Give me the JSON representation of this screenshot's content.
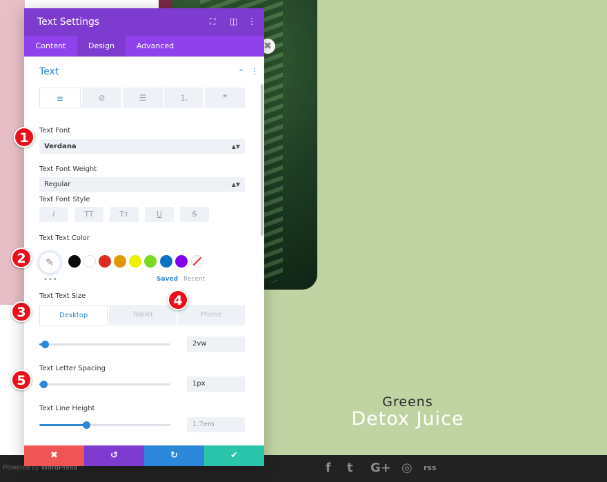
{
  "panel": {
    "title": "Text Settings",
    "header_icons": [
      "expand-icon",
      "columns-icon",
      "more-icon"
    ],
    "tabs": [
      {
        "label": "Content",
        "active": false
      },
      {
        "label": "Design",
        "active": true
      },
      {
        "label": "Advanced",
        "active": false
      }
    ],
    "section": {
      "title": "Text"
    },
    "alignment_options": [
      "align-left-icon",
      "link-off-icon",
      "list-icon",
      "ordered-list-icon",
      "quote-icon"
    ],
    "fields": {
      "font": {
        "label": "Text Font",
        "value": "Verdana"
      },
      "font_weight": {
        "label": "Text Font Weight",
        "value": "Regular"
      },
      "font_style": {
        "label": "Text Font Style",
        "options": [
          "I",
          "TT",
          "Tт",
          "U",
          "S"
        ]
      },
      "text_color": {
        "label": "Text Text Color",
        "swatches": [
          "#0b0b0b",
          "#ffffff",
          "#e02b20",
          "#e09900",
          "#edf000",
          "#7cda24",
          "#0c71c3",
          "#8300e9"
        ],
        "saved_label": "Saved",
        "recent_label": "Recent",
        "ellipsis": "•••"
      },
      "text_size": {
        "label": "Text Text Size",
        "devices": [
          {
            "label": "Desktop",
            "active": true
          },
          {
            "label": "Tablet",
            "active": false
          },
          {
            "label": "Phone",
            "active": false
          }
        ],
        "value": "2vw",
        "slider_fraction": 0.04
      },
      "letter_spacing": {
        "label": "Text Letter Spacing",
        "value": "1px",
        "slider_fraction": 0.03
      },
      "line_height": {
        "label": "Text Line Height",
        "value": "1.7em",
        "slider_fraction": 0.36
      }
    },
    "actions": {
      "cancel": "✖",
      "undo": "↺",
      "redo": "↻",
      "save": "✔"
    }
  },
  "badges": [
    "1",
    "2",
    "3",
    "4",
    "5"
  ],
  "preview": {
    "line1": "Greens",
    "line2": "Detox Juice"
  },
  "footer": {
    "powered_prefix": "Powered by",
    "powered_brand": "WordPress",
    "social": [
      "f",
      "t",
      "G+",
      "◎",
      "rss"
    ]
  },
  "colors": {
    "header": "#7e3bd0",
    "tabs": "#8f42ec",
    "accent": "#2e86d6",
    "cancel": "#ef5555",
    "undo": "#7e3bd0",
    "redo": "#2b87da",
    "save": "#29c4a9",
    "badge": "#e8101a"
  }
}
